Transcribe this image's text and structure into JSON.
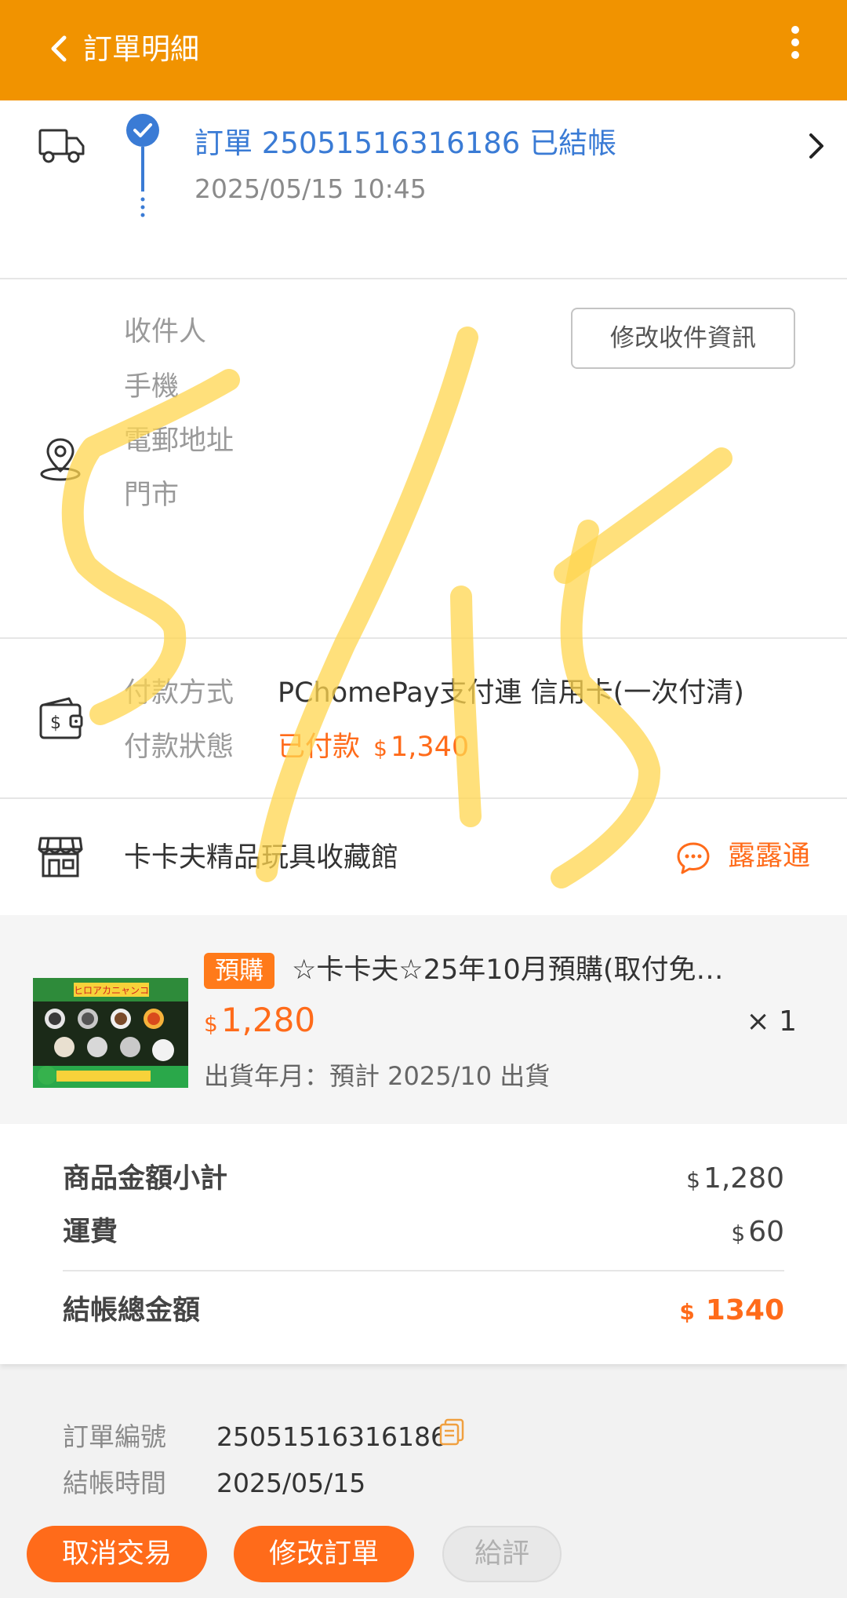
{
  "header": {
    "title": "訂單明細",
    "back_icon": "chevron-left-icon",
    "more_icon": "more-vertical-icon"
  },
  "status": {
    "title": "訂單 25051516316186 已結帳",
    "time": "2025/05/15 10:45"
  },
  "receiver": {
    "labels": [
      "收件人",
      "手機",
      "電郵地址",
      "門市"
    ],
    "edit_button": "修改收件資訊"
  },
  "payment": {
    "method_label": "付款方式",
    "method_value": "PChomePay支付連 信用卡(一次付清)",
    "status_label": "付款狀態",
    "status_value": "已付款",
    "status_currency": "$",
    "status_amount": "1,340"
  },
  "shop": {
    "name": "卡卡夫精品玩具收藏館",
    "chat_label": "露露通"
  },
  "product": {
    "badge": "預購",
    "name": "☆卡卡夫☆25年10月預購(取付免…",
    "currency": "$",
    "price": "1,280",
    "qty": "× 1",
    "ship_date": "出貨年月：預計 2025/10 出貨",
    "thumb_caption": "ヒロアカニャンコ"
  },
  "totals": {
    "subtotal_label": "商品金額小計",
    "subtotal_currency": "$",
    "subtotal_value": "1,280",
    "shipping_label": "運費",
    "shipping_currency": "$",
    "shipping_value": "60",
    "total_label": "結帳總金額",
    "total_currency": "$",
    "total_value": "1340"
  },
  "order_info": {
    "number_label": "訂單編號",
    "number_value": "25051516316186",
    "time_label": "結帳時間",
    "time_value": "2025/05/15"
  },
  "actions": {
    "cancel": "取消交易",
    "modify": "修改訂單",
    "rate": "給評"
  },
  "colors": {
    "header": "#f19300",
    "accent": "#ff6b1a",
    "link_blue": "#3a7bd5",
    "scribble": "#ffd54f"
  }
}
